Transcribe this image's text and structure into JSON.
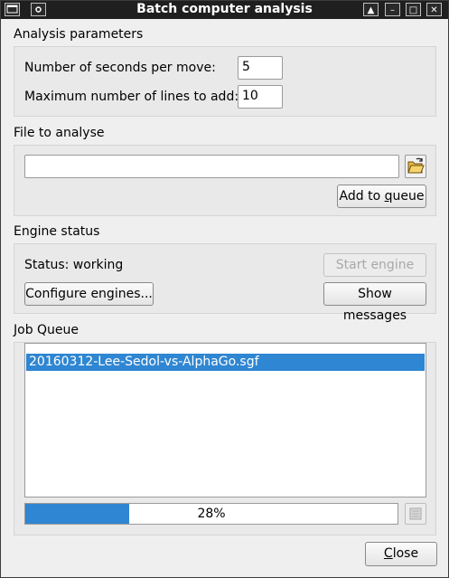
{
  "window": {
    "title": "Batch computer analysis",
    "controls": [
      "▲",
      "–",
      "□",
      "✕"
    ]
  },
  "analysis": {
    "title": "Analysis parameters",
    "seconds_label": "Number of seconds per move:",
    "seconds_value": "5",
    "lines_label": "Maximum number of lines to add:",
    "lines_value": "10"
  },
  "file": {
    "title": "File to analyse",
    "path_value": "",
    "add_button": "Add to queue"
  },
  "engine": {
    "title": "Engine status",
    "status_text": "Status: working",
    "start_button": "Start engine",
    "configure_button": "Configure engines...",
    "messages_button": "Show messages"
  },
  "queue": {
    "title": "Job Queue",
    "items": [
      "20160312-Lee-Sedol-vs-AlphaGo.sgf"
    ],
    "selected_index": 0,
    "progress_percent": 28,
    "progress_label": "28%"
  },
  "footer": {
    "close_button": "Close"
  },
  "colors": {
    "accent": "#2f86d2",
    "titlebar": "#1f1f1f",
    "background": "#efefef"
  }
}
